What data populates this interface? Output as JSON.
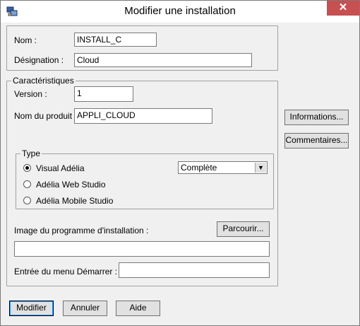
{
  "window": {
    "title": "Modifier une installation",
    "close_symbol": "✕"
  },
  "identity": {
    "nom_label": "Nom :",
    "nom_value": "INSTALL_C",
    "designation_label": "Désignation :",
    "designation_value": "Cloud"
  },
  "caracteristiques": {
    "legend": "Caractéristiques",
    "version_label": "Version :",
    "version_value": "1",
    "produit_label": "Nom du produit :",
    "produit_value": "APPLI_CLOUD",
    "type": {
      "legend": "Type",
      "options": [
        "Visual Adélia",
        "Adélia Web Studio",
        "Adélia Mobile Studio"
      ],
      "selected_index": 0,
      "mode_value": "Complète"
    },
    "image_label": "Image du programme d'installation :",
    "image_value": "",
    "parcourir_label": "Parcourir...",
    "menu_label": "Entrée du menu Démarrer :",
    "menu_value": ""
  },
  "side_buttons": {
    "informations": "Informations...",
    "commentaires": "Commentaires..."
  },
  "bottom_buttons": {
    "modifier": "Modifier",
    "annuler": "Annuler",
    "aide": "Aide"
  }
}
